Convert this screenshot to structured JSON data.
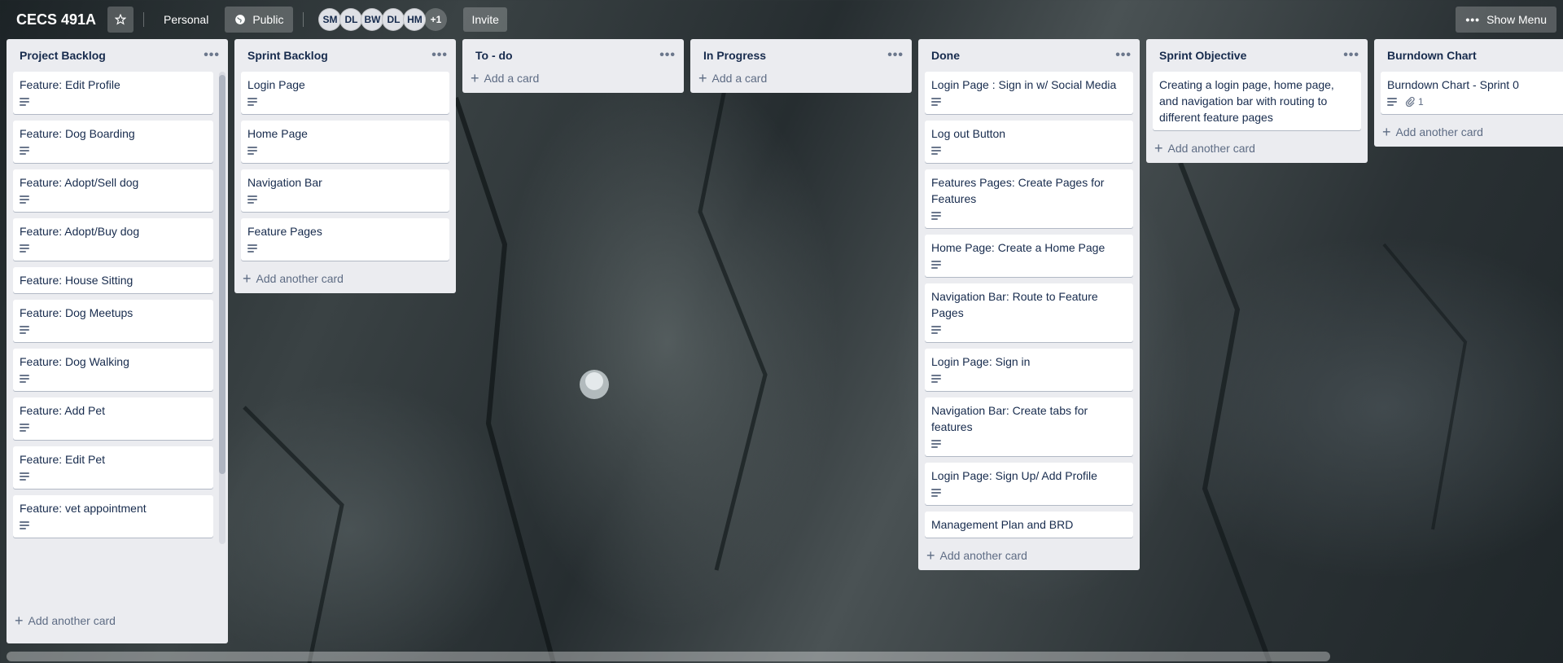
{
  "board": {
    "title": "CECS 491A",
    "visibility_personal": "Personal",
    "visibility_public": "Public",
    "members": [
      "SM",
      "DL",
      "BW",
      "DL",
      "HM"
    ],
    "members_more": "+1",
    "invite_label": "Invite",
    "show_menu_label": "Show Menu"
  },
  "lists": [
    {
      "title": "Project Backlog",
      "cards": [
        {
          "title": "Feature: Edit Profile"
        },
        {
          "title": "Feature: Dog Boarding"
        },
        {
          "title": "Feature: Adopt/Sell dog"
        },
        {
          "title": "Feature: Adopt/Buy dog"
        },
        {
          "title": "Feature: House Sitting"
        },
        {
          "title": "Feature: Dog Meetups"
        },
        {
          "title": "Feature: Dog Walking"
        },
        {
          "title": "Feature: Add Pet"
        },
        {
          "title": "Feature: Edit Pet"
        },
        {
          "title": "Feature: vet appointment"
        }
      ],
      "add_label": "Add another card"
    },
    {
      "title": "Sprint Backlog",
      "cards": [
        {
          "title": "Login Page"
        },
        {
          "title": "Home Page"
        },
        {
          "title": "Navigation Bar"
        },
        {
          "title": "Feature Pages"
        }
      ],
      "add_label": "Add another card"
    },
    {
      "title": "To - do",
      "cards": [],
      "add_label": "Add a card"
    },
    {
      "title": "In Progress",
      "cards": [],
      "add_label": "Add a card"
    },
    {
      "title": "Done",
      "cards": [
        {
          "title": "Login Page : Sign in w/ Social Media"
        },
        {
          "title": "Log out Button"
        },
        {
          "title": "Features Pages: Create Pages for Features"
        },
        {
          "title": "Home Page: Create a Home Page"
        },
        {
          "title": "Navigation Bar: Route to Feature Pages"
        },
        {
          "title": "Login Page: Sign in"
        },
        {
          "title": "Navigation Bar: Create tabs for features"
        },
        {
          "title": "Login Page: Sign Up/ Add Profile"
        },
        {
          "title": "Management Plan and BRD"
        }
      ],
      "add_label": "Add another card"
    },
    {
      "title": "Sprint Objective",
      "cards": [
        {
          "title": "Creating a login page, home page, and navigation bar with routing to different feature pages"
        }
      ],
      "add_label": "Add another card"
    },
    {
      "title": "Burndown Chart",
      "cards": [
        {
          "title": "Burndown Chart - Sprint 0",
          "attachments": "1"
        }
      ],
      "add_label": "Add another card"
    }
  ]
}
